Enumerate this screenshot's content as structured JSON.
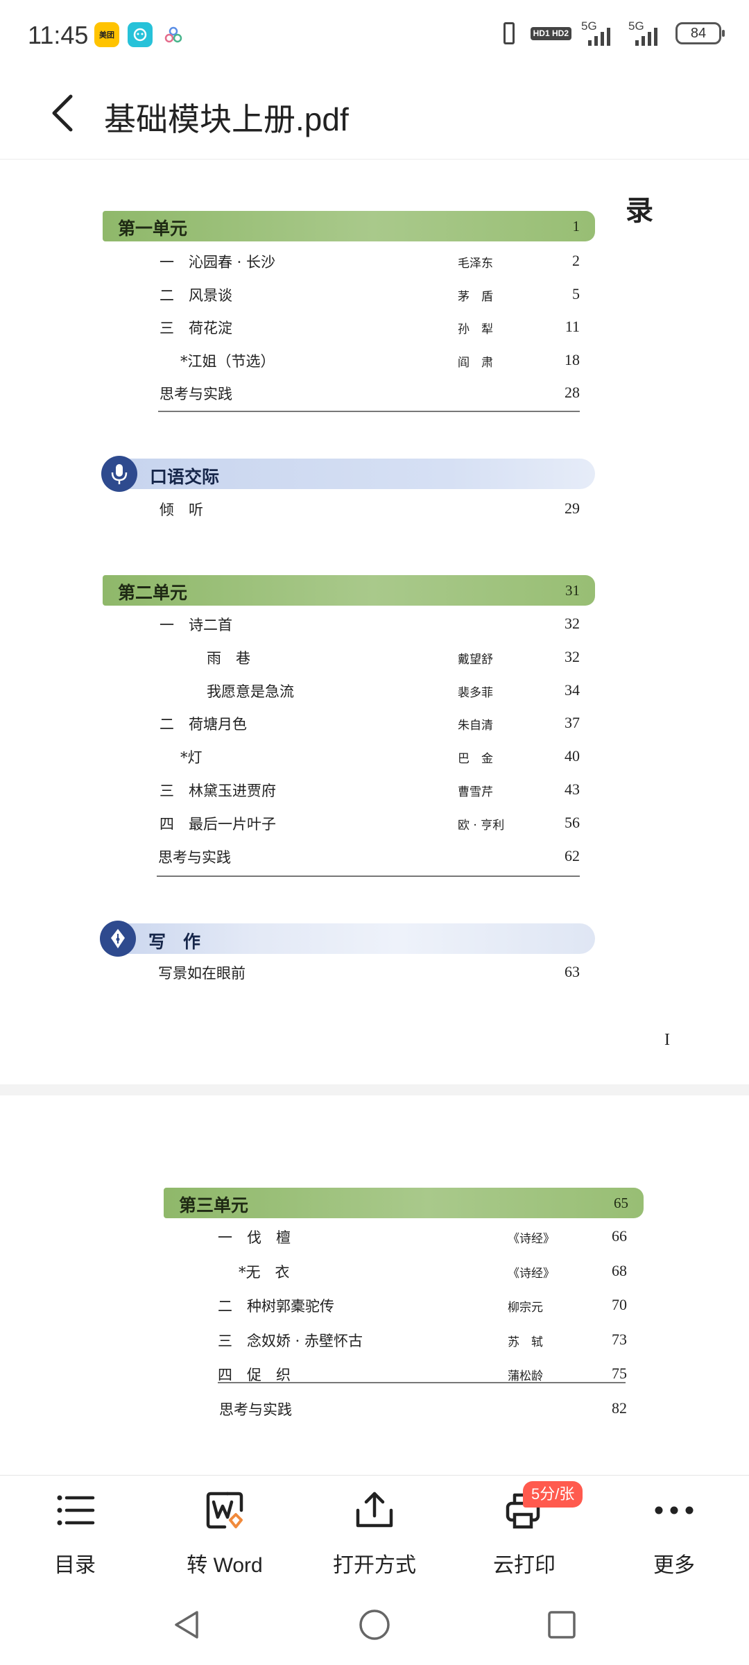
{
  "status_bar": {
    "time": "11:45",
    "app_icons": [
      "meituan-icon",
      "chat-app-icon",
      "cloud-app-icon"
    ],
    "meituan_label": "美团",
    "hd_label": "HD1 HD2",
    "sim1_label": "5G",
    "sim2_label": "5G",
    "battery": "84"
  },
  "title_bar": {
    "title": "基础模块上册.pdf"
  },
  "document": {
    "toc_heading": "录",
    "page_one_number": "I",
    "units": [
      {
        "title": "第一单元",
        "page": "1"
      },
      {
        "title": "第二单元",
        "page": "31"
      },
      {
        "title": "第三单元",
        "page": "65"
      }
    ],
    "sections": [
      {
        "title": "口语交际"
      },
      {
        "title": "写　作"
      }
    ],
    "unit1_entries": [
      {
        "label": "一　沁园春 · 长沙",
        "author": "毛泽东",
        "page": "2"
      },
      {
        "label": "二　风景谈",
        "author": "茅　盾",
        "page": "5"
      },
      {
        "label": "三　荷花淀",
        "author": "孙　犁",
        "page": "11"
      },
      {
        "label": "*江姐（节选）",
        "author": "阎　肃",
        "page": "18"
      },
      {
        "label": "思考与实践",
        "author": "",
        "page": "28"
      }
    ],
    "speaking_entries": [
      {
        "label": "倾　听",
        "author": "",
        "page": "29"
      }
    ],
    "unit2_entries": [
      {
        "label": "一　诗二首",
        "author": "",
        "page": "32"
      },
      {
        "label": "雨　巷",
        "author": "戴望舒",
        "page": "32"
      },
      {
        "label": "我愿意是急流",
        "author": "裴多菲",
        "page": "34"
      },
      {
        "label": "二　荷塘月色",
        "author": "朱自清",
        "page": "37"
      },
      {
        "label": "*灯",
        "author": "巴　金",
        "page": "40"
      },
      {
        "label": "三　林黛玉进贾府",
        "author": "曹雪芹",
        "page": "43"
      },
      {
        "label": "四　最后一片叶子",
        "author": "欧 · 亨利",
        "page": "56"
      },
      {
        "label": "思考与实践",
        "author": "",
        "page": "62"
      }
    ],
    "writing_entries": [
      {
        "label": "写景如在眼前",
        "author": "",
        "page": "63"
      }
    ],
    "unit3_entries": [
      {
        "label": "一　伐　檀",
        "author": "《诗经》",
        "page": "66"
      },
      {
        "label": "*无　衣",
        "author": "《诗经》",
        "page": "68"
      },
      {
        "label": "二　种树郭橐驼传",
        "author": "柳宗元",
        "page": "70"
      },
      {
        "label": "三　念奴娇 · 赤壁怀古",
        "author": "苏　轼",
        "page": "73"
      },
      {
        "label": "四　促　织",
        "author": "蒲松龄",
        "page": "75"
      },
      {
        "label": "思考与实践",
        "author": "",
        "page": "82"
      }
    ]
  },
  "toolbar": {
    "items": [
      {
        "label": "目录",
        "icon": "list-icon"
      },
      {
        "label": "转 Word",
        "icon": "word-convert-icon"
      },
      {
        "label": "打开方式",
        "icon": "share-icon"
      },
      {
        "label": "云打印",
        "icon": "print-icon"
      },
      {
        "label": "更多",
        "icon": "more-icon"
      }
    ],
    "price_badge": "5分/张",
    "accent_color": "#ff5a4e"
  },
  "navbar": {
    "buttons": [
      "back-triangle-icon",
      "home-circle-icon",
      "recents-square-icon"
    ]
  }
}
